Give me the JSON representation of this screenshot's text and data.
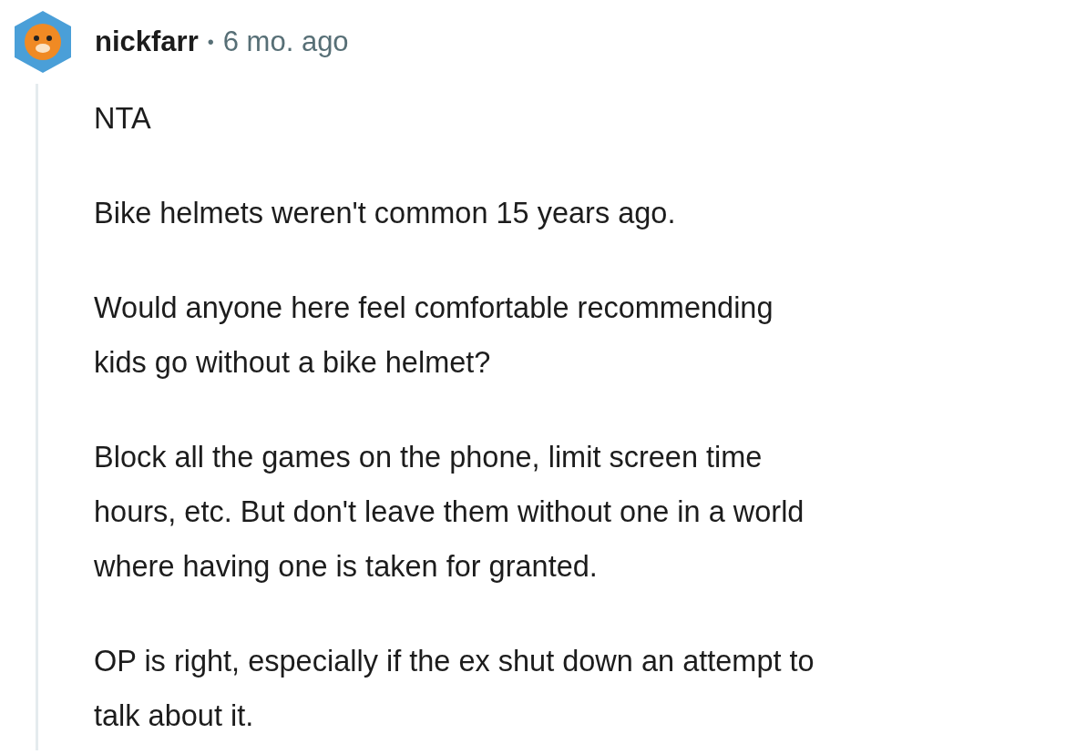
{
  "comment": {
    "author": "nickfarr",
    "separator": "•",
    "age": "6 mo. ago",
    "paragraphs": [
      "NTA",
      "Bike helmets weren't common 15 years ago.",
      "Would anyone here feel comfortable recommending\nkids go without a bike helmet?",
      "Block all the games on the phone, limit screen time\nhours, etc. But don't leave them without one in a world\nwhere having one is taken for granted.",
      "OP is right, especially if the ex shut down an attempt to\ntalk about it."
    ]
  }
}
